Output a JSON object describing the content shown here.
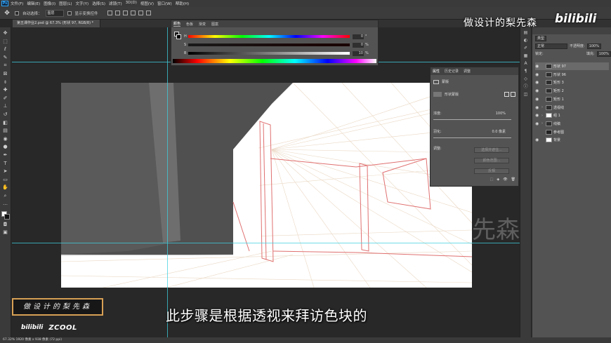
{
  "app": {
    "logo": "Ps"
  },
  "menubar": {
    "items": [
      "文件(F)",
      "编辑(E)",
      "图像(I)",
      "图层(L)",
      "文字(Y)",
      "选择(S)",
      "滤镜(T)",
      "3D(D)",
      "视图(V)",
      "窗口(W)",
      "帮助(H)"
    ]
  },
  "options": {
    "auto_select_label": "自动选择：",
    "auto_select_value": "图层",
    "transform_label": "显示变换控件"
  },
  "document": {
    "tab_title": "第五课作业2.psd @ 67.3% (形状 97, RGB/8) *"
  },
  "color_panel": {
    "tabs": [
      "颜色",
      "色板",
      "渐变",
      "图案"
    ],
    "rows": [
      {
        "channel": "H",
        "value": "0"
      },
      {
        "channel": "S",
        "value": "0"
      },
      {
        "channel": "B",
        "value": "10"
      }
    ],
    "unit": "%"
  },
  "properties_panel": {
    "tabs": [
      "属性",
      "历史记录",
      "调整"
    ],
    "section_label": "蒙版",
    "vector_mask_label": "形状蒙版",
    "density_label": "浓度:",
    "density_value": "100%",
    "feather_label": "羽化:",
    "feather_value": "0.0 像素",
    "refine_label": "调整:",
    "button_select_mask": "选择并遮住...",
    "button_color_range": "颜色范围...",
    "button_invert": "反相"
  },
  "layers_panel": {
    "kind_label": "类型",
    "blend_mode": "正常",
    "opacity_label": "不透明度:",
    "opacity_value": "100%",
    "lock_label": "锁定:",
    "fill_label": "填充:",
    "fill_value": "100%",
    "layers": [
      {
        "name": "形状 97",
        "selected": true
      },
      {
        "name": "形状 96",
        "selected": false
      },
      {
        "name": "矩形 3",
        "selected": false
      },
      {
        "name": "矩形 2",
        "selected": false
      },
      {
        "name": "矩形 1",
        "selected": false
      },
      {
        "name": "透视线",
        "selected": false
      },
      {
        "name": "组 1",
        "selected": false
      },
      {
        "name": "线稿",
        "selected": false
      },
      {
        "name": "参考图",
        "selected": false
      },
      {
        "name": "背景",
        "selected": false
      }
    ]
  },
  "status": {
    "text": "67.32%    1920 像素 x 938 像素 (72 ppi)"
  },
  "overlay": {
    "subtitle": "此步骤是根据透视来拜访色块的",
    "author": "做设计的梨先森",
    "watermark_top": "做设计的梨先森",
    "watermark_brand": "bilibili",
    "canvas_watermark": "先森",
    "logo_bilibili": "bilibili",
    "logo_zcool": "ZCOOL"
  },
  "colors": {
    "accent": "#31a8ff",
    "guide": "#3fd0e0",
    "perspective_line": "#e07070",
    "author_border": "#d7a055"
  }
}
